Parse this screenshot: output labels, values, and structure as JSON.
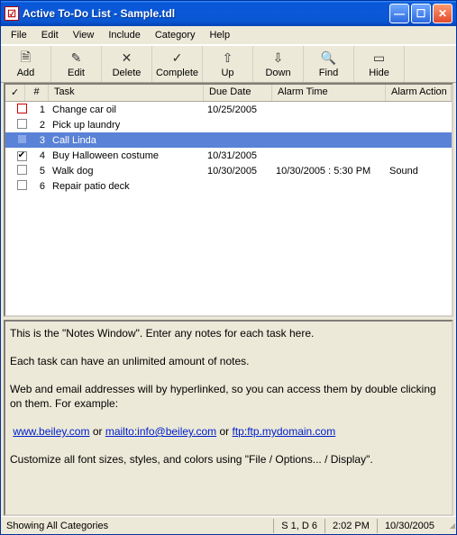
{
  "title": "Active To-Do List - Sample.tdl",
  "menu": [
    "File",
    "Edit",
    "View",
    "Include",
    "Category",
    "Help"
  ],
  "toolbar": [
    {
      "name": "add-button",
      "icon": "add-icon",
      "glyph": "🗎",
      "label": "Add"
    },
    {
      "name": "edit-button",
      "icon": "edit-icon",
      "glyph": "✎",
      "label": "Edit"
    },
    {
      "name": "delete-button",
      "icon": "delete-icon",
      "glyph": "✕",
      "label": "Delete"
    },
    {
      "name": "complete-button",
      "icon": "complete-icon",
      "glyph": "✓",
      "label": "Complete"
    },
    {
      "name": "up-button",
      "icon": "up-icon",
      "glyph": "⇧",
      "label": "Up"
    },
    {
      "name": "down-button",
      "icon": "down-icon",
      "glyph": "⇩",
      "label": "Down"
    },
    {
      "name": "find-button",
      "icon": "find-icon",
      "glyph": "🔍",
      "label": "Find"
    },
    {
      "name": "hide-button",
      "icon": "hide-icon",
      "glyph": "▭",
      "label": "Hide"
    }
  ],
  "columns": {
    "check": "✓",
    "num": "#",
    "task": "Task",
    "due": "Due Date",
    "alarm": "Alarm Time",
    "action": "Alarm Action"
  },
  "tasks": [
    {
      "num": "1",
      "task": "Change car oil",
      "due": "10/25/2005",
      "alarm": "",
      "action": "",
      "checked": false,
      "chkcls": "red",
      "sel": false
    },
    {
      "num": "2",
      "task": "Pick up laundry",
      "due": "",
      "alarm": "",
      "action": "",
      "checked": false,
      "chkcls": "",
      "sel": false
    },
    {
      "num": "3",
      "task": "Call Linda",
      "due": "",
      "alarm": "",
      "action": "",
      "checked": false,
      "chkcls": "blue",
      "sel": true
    },
    {
      "num": "4",
      "task": "Buy Halloween costume",
      "due": "10/31/2005",
      "alarm": "",
      "action": "",
      "checked": true,
      "chkcls": "",
      "sel": false
    },
    {
      "num": "5",
      "task": "Walk dog",
      "due": "10/30/2005",
      "alarm": "10/30/2005 : 5:30 PM",
      "action": "Sound",
      "checked": false,
      "chkcls": "",
      "sel": false
    },
    {
      "num": "6",
      "task": "Repair patio deck",
      "due": "",
      "alarm": "",
      "action": "",
      "checked": false,
      "chkcls": "",
      "sel": false
    }
  ],
  "notes": {
    "l1": "This is the \"Notes Window\".  Enter any notes for each task here.",
    "l2": "Each task can have an unlimited amount of notes.",
    "l3": "Web and email addresses will by hyperlinked, so you can access them by double clicking on them.  For example:",
    "link1": "www.beiley.com",
    "or1": " or ",
    "link2": "mailto:info@beiley.com",
    "or2": " or ",
    "link3": "ftp:ftp.mydomain.com",
    "l4": "Customize all font sizes, styles, and colors using \"File / Options... / Display\"."
  },
  "status": {
    "cats": "Showing All Categories",
    "sd": "S 1, D 6",
    "time": "2:02 PM",
    "date": "10/30/2005"
  }
}
